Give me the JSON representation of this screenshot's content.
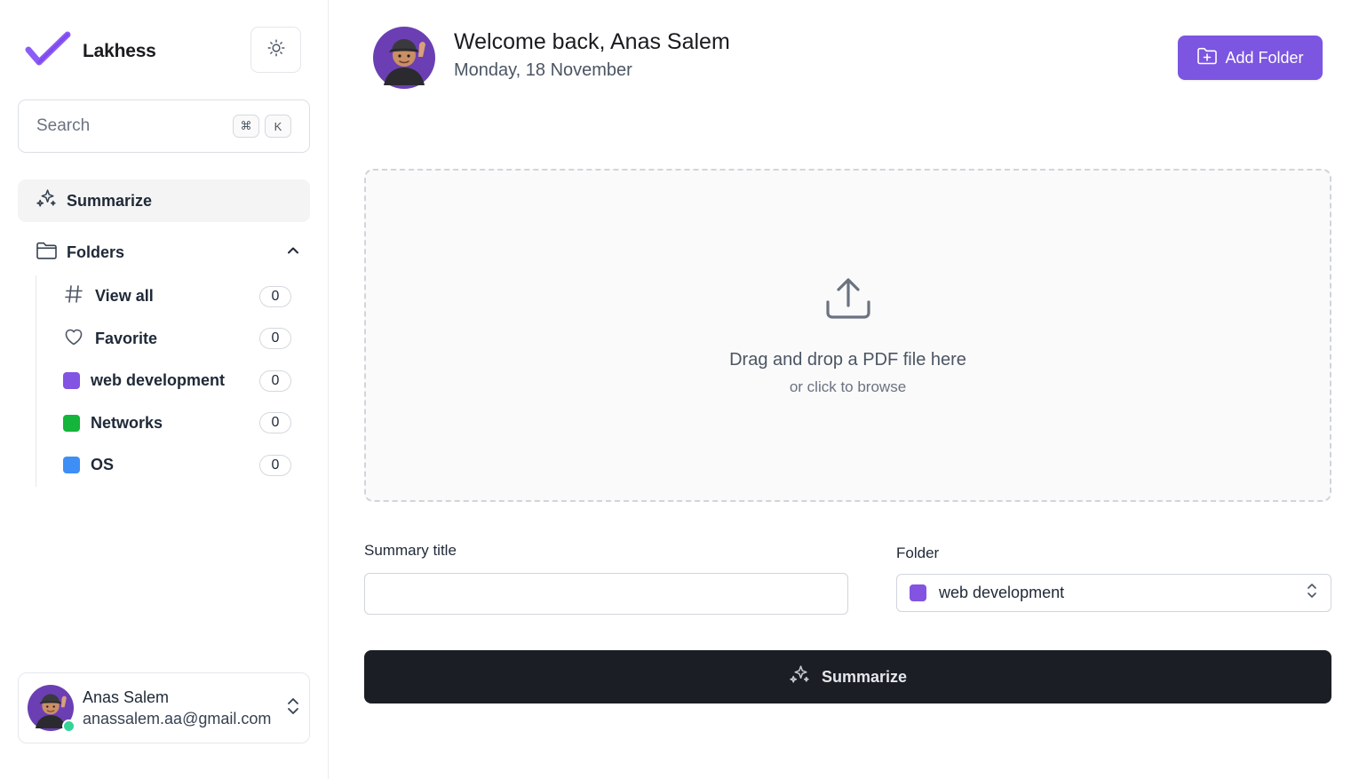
{
  "brand": {
    "name": "Lakhess",
    "logo_icon": "check-logo-icon",
    "accent": "#7c55e0"
  },
  "sidebar": {
    "theme_toggle_icon": "sun-icon",
    "search": {
      "placeholder": "Search",
      "shortcut_keys": [
        "⌘",
        "K"
      ]
    },
    "summarize": {
      "label": "Summarize",
      "icon": "sparkles-icon"
    },
    "folders": {
      "label": "Folders",
      "expanded": true,
      "items": [
        {
          "label": "View all",
          "count": "0",
          "icon": "hash-icon"
        },
        {
          "label": "Favorite",
          "count": "0",
          "icon": "heart-icon"
        },
        {
          "label": "web development",
          "count": "0",
          "color": "#8353e2"
        },
        {
          "label": "Networks",
          "count": "0",
          "color": "#15b43a"
        },
        {
          "label": "OS",
          "count": "0",
          "color": "#3d8ff5"
        }
      ]
    },
    "user": {
      "name": "Anas Salem",
      "email": "anassalem.aa@gmail.com",
      "status": "online"
    }
  },
  "header": {
    "welcome": "Welcome back, Anas Salem",
    "date": "Monday, 18 November",
    "add_folder_label": "Add Folder"
  },
  "dropzone": {
    "title": "Drag and drop a PDF file here",
    "subtitle": "or click to browse",
    "icon": "upload-icon"
  },
  "form": {
    "summary_title_label": "Summary title",
    "summary_title_value": "",
    "folder_label": "Folder",
    "folder_value": "web development",
    "folder_color": "#8353e2",
    "submit_label": "Summarize"
  }
}
